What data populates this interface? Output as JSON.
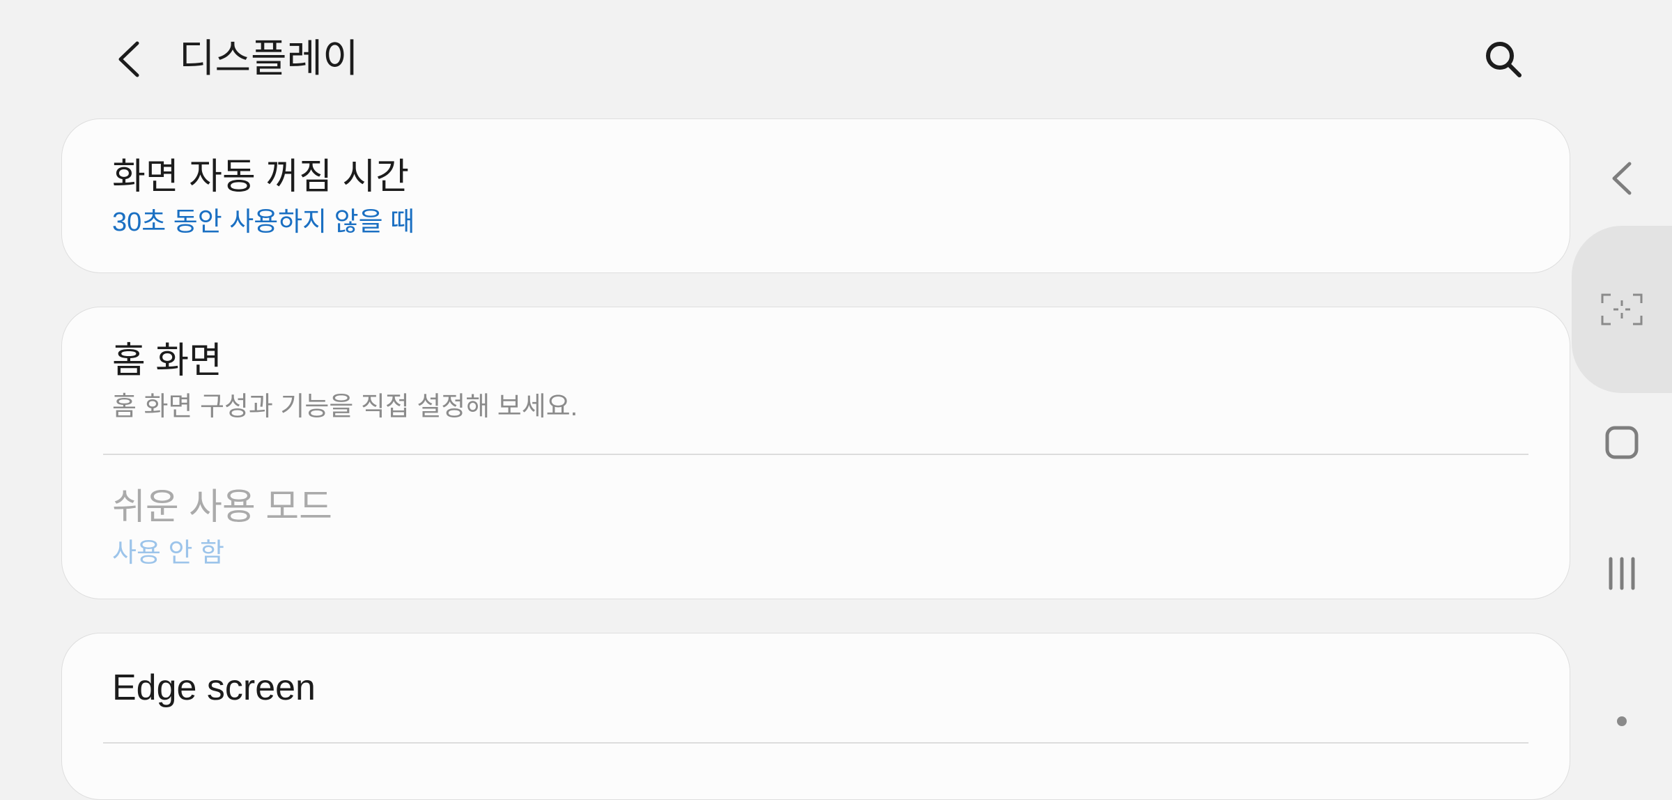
{
  "header": {
    "title": "디스플레이",
    "back_icon": "back-arrow-icon",
    "search_icon": "search-icon"
  },
  "cards": [
    {
      "items": [
        {
          "title": "화면 자동 꺼짐 시간",
          "subtitle": "30초 동안 사용하지 않을 때"
        }
      ]
    },
    {
      "items": [
        {
          "title": "홈 화면",
          "subtitle": "홈 화면 구성과 기능을 직접 설정해 보세요."
        },
        {
          "title": "쉬운 사용 모드",
          "subtitle": "사용 안 함",
          "enabled": false
        }
      ]
    },
    {
      "items": [
        {
          "title": "Edge screen"
        }
      ]
    }
  ],
  "navigation_bar": {
    "buttons": [
      "back-icon",
      "screenshot-icon",
      "home-icon",
      "recents-icon",
      "dot-icon"
    ]
  },
  "colors": {
    "background": "#f2f2f2",
    "card": "#fcfcfc",
    "accent": "#1a6fc2",
    "disabled_accent": "#9cc4ea"
  }
}
